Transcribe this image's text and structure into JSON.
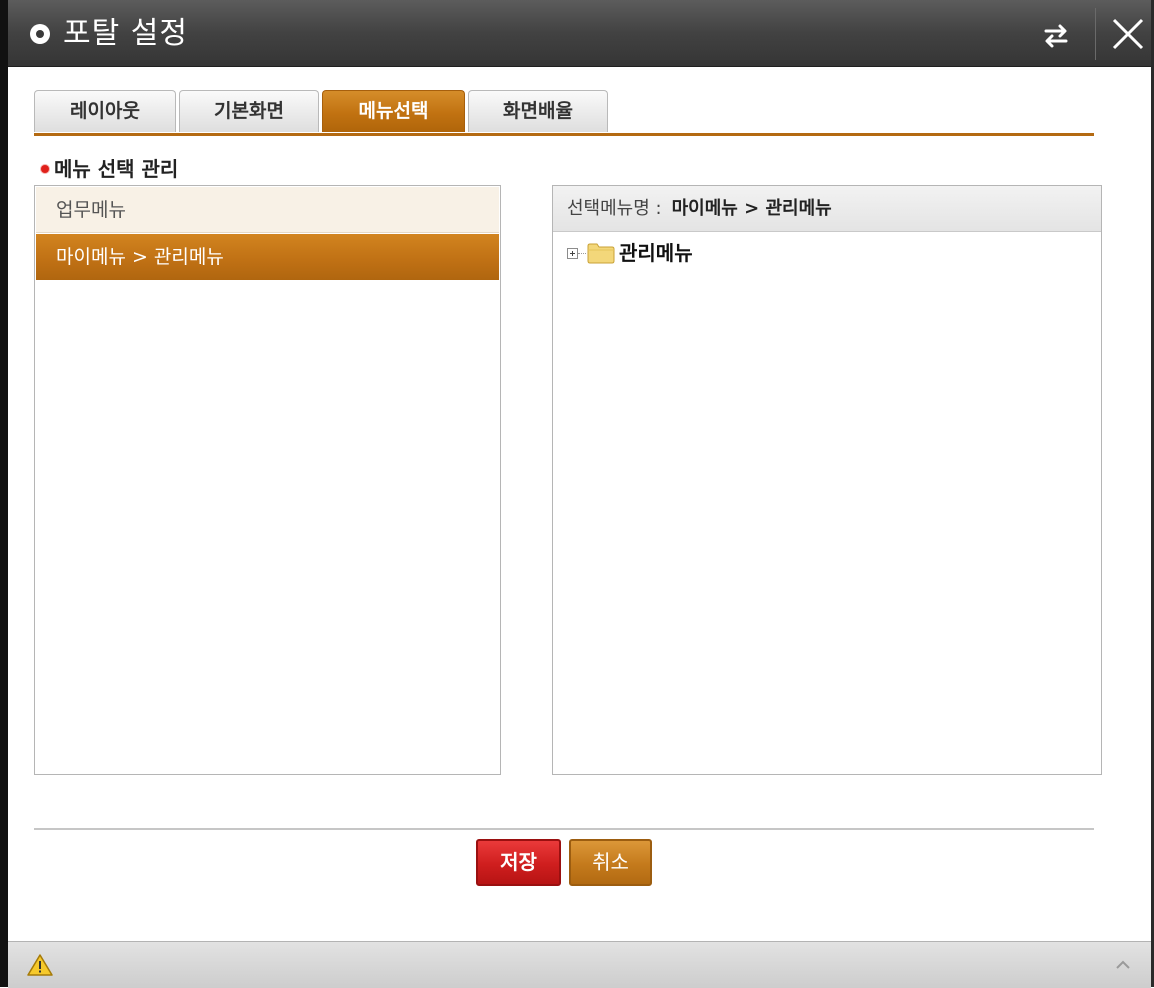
{
  "window": {
    "title": "포탈 설정",
    "refresh_icon": "swap-arrows-icon",
    "close_icon": "close-icon"
  },
  "tabs": [
    {
      "label": "레이아웃",
      "active": false
    },
    {
      "label": "기본화면",
      "active": false
    },
    {
      "label": "메뉴선택",
      "active": true
    },
    {
      "label": "화면배율",
      "active": false
    }
  ],
  "section": {
    "title": "메뉴 선택 관리"
  },
  "menu_list": {
    "items": [
      {
        "label": "업무메뉴",
        "selected": false
      },
      {
        "label": "마이메뉴 > 관리메뉴",
        "selected": true
      }
    ]
  },
  "tree_panel": {
    "header_label": "선택메뉴명 :",
    "header_path": "마이메뉴 > 관리메뉴",
    "nodes": [
      {
        "label": "관리메뉴",
        "expanded": false,
        "icon": "folder-icon"
      }
    ]
  },
  "buttons": {
    "save": "저장",
    "cancel": "취소"
  },
  "status_bar": {
    "warning_icon": "warning-icon",
    "collapse_icon": "chevron-up-icon"
  },
  "colors": {
    "accent": "#c17211",
    "save": "#cf1e1e",
    "titlebar": "#424242"
  }
}
